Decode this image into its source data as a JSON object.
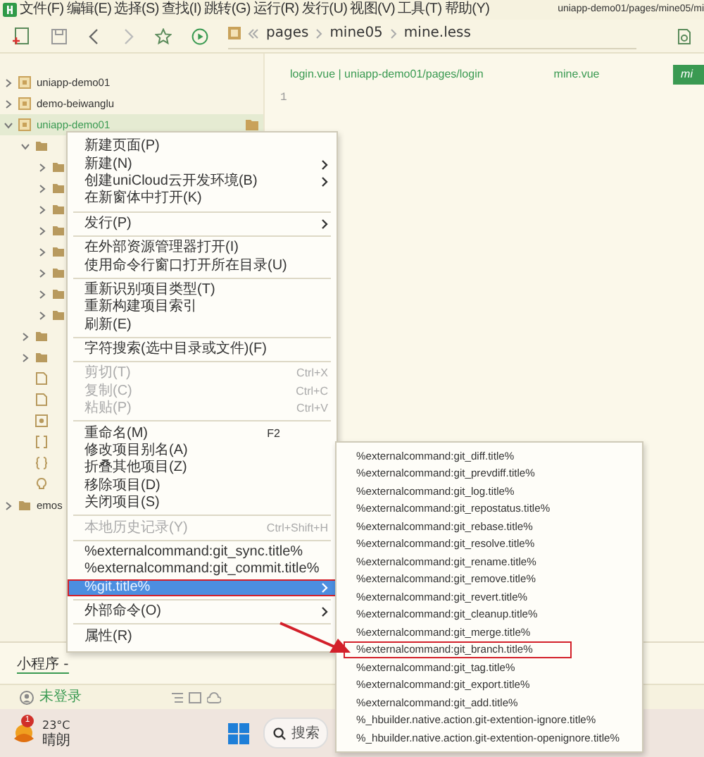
{
  "menubar": {
    "items": [
      "文件(F)",
      "编辑(E)",
      "选择(S)",
      "查找(I)",
      "跳转(G)",
      "运行(R)",
      "发行(U)",
      "视图(V)",
      "工具(T)",
      "帮助(Y)"
    ],
    "title": "uniapp-demo01/pages/mine05/mi"
  },
  "breadcrumb": [
    "pages",
    "mine05",
    "mine.less"
  ],
  "tree": [
    {
      "kind": "project",
      "label": "uniapp-demo01",
      "expanded": false,
      "selected": false
    },
    {
      "kind": "project",
      "label": "demo-beiwanglu",
      "expanded": false,
      "selected": false
    },
    {
      "kind": "project",
      "label": "uniapp-demo01",
      "expanded": true,
      "selected": true,
      "children": [
        {
          "kind": "folder",
          "expanded": true,
          "children": [
            {
              "kind": "folder",
              "expanded": false
            },
            {
              "kind": "folder",
              "expanded": false
            },
            {
              "kind": "folder",
              "expanded": false
            },
            {
              "kind": "folder",
              "expanded": false
            },
            {
              "kind": "folder",
              "expanded": false
            },
            {
              "kind": "folder",
              "expanded": false
            },
            {
              "kind": "folder",
              "expanded": false
            },
            {
              "kind": "folder",
              "expanded": false
            }
          ]
        },
        {
          "kind": "folder",
          "expanded": false
        },
        {
          "kind": "folder",
          "expanded": false
        },
        {
          "kind": "file"
        },
        {
          "kind": "file"
        },
        {
          "kind": "config"
        },
        {
          "kind": "brackets"
        },
        {
          "kind": "braces"
        },
        {
          "kind": "hint"
        }
      ]
    },
    {
      "kind": "folder",
      "label": "emos",
      "expanded": false,
      "selected": false
    }
  ],
  "editor_tabs": [
    {
      "label": "login.vue | uniapp-demo01/pages/login",
      "selected": false
    },
    {
      "label": "mine.vue",
      "selected": false
    },
    {
      "label": "mi",
      "selected": true
    }
  ],
  "line_numbers": [
    "1"
  ],
  "context_menu": [
    {
      "kind": "item",
      "label": "新建页面(P)",
      "disabled": false,
      "submenu": false,
      "selected": false,
      "annotated": false
    },
    {
      "kind": "item",
      "label": "新建(N)",
      "disabled": false,
      "submenu": true,
      "selected": false,
      "annotated": false
    },
    {
      "kind": "item",
      "label": "创建uniCloud云开发环境(B)",
      "disabled": false,
      "submenu": true,
      "selected": false,
      "annotated": false
    },
    {
      "kind": "item",
      "label": "在新窗体中打开(K)",
      "disabled": false,
      "submenu": false,
      "selected": false,
      "annotated": false
    },
    {
      "kind": "separator"
    },
    {
      "kind": "item",
      "label": "发行(P)",
      "disabled": false,
      "submenu": true,
      "selected": false,
      "annotated": false
    },
    {
      "kind": "separator"
    },
    {
      "kind": "item",
      "label": "在外部资源管理器打开(I)",
      "disabled": false,
      "submenu": false,
      "selected": false,
      "annotated": false
    },
    {
      "kind": "item",
      "label": "使用命令行窗口打开所在目录(U)",
      "disabled": false,
      "submenu": false,
      "selected": false,
      "annotated": false
    },
    {
      "kind": "separator"
    },
    {
      "kind": "item",
      "label": "重新识别项目类型(T)",
      "disabled": false,
      "submenu": false,
      "selected": false,
      "annotated": false
    },
    {
      "kind": "item",
      "label": "重新构建项目索引",
      "disabled": false,
      "submenu": false,
      "selected": false,
      "annotated": false
    },
    {
      "kind": "item",
      "label": "刷新(E)",
      "disabled": false,
      "submenu": false,
      "selected": false,
      "annotated": false
    },
    {
      "kind": "separator"
    },
    {
      "kind": "item",
      "label": "字符搜索(选中目录或文件)(F)",
      "disabled": false,
      "submenu": false,
      "selected": false,
      "annotated": false
    },
    {
      "kind": "separator"
    },
    {
      "kind": "item",
      "label": "剪切(T)",
      "shortcut": "Ctrl+X",
      "disabled": true,
      "submenu": false,
      "selected": false,
      "annotated": false
    },
    {
      "kind": "item",
      "label": "复制(C)",
      "shortcut": "Ctrl+C",
      "disabled": true,
      "submenu": false,
      "selected": false,
      "annotated": false
    },
    {
      "kind": "item",
      "label": "粘贴(P)",
      "shortcut": "Ctrl+V",
      "disabled": true,
      "submenu": false,
      "selected": false,
      "annotated": false
    },
    {
      "kind": "separator"
    },
    {
      "kind": "item",
      "label": "重命名(M)",
      "shortcut": "F2",
      "disabled": false,
      "submenu": false,
      "selected": false,
      "annotated": false
    },
    {
      "kind": "item",
      "label": "修改项目别名(A)",
      "disabled": false,
      "submenu": false,
      "selected": false,
      "annotated": false
    },
    {
      "kind": "item",
      "label": "折叠其他项目(Z)",
      "disabled": false,
      "submenu": false,
      "selected": false,
      "annotated": false
    },
    {
      "kind": "item",
      "label": "移除项目(D)",
      "disabled": false,
      "submenu": false,
      "selected": false,
      "annotated": false
    },
    {
      "kind": "item",
      "label": "关闭项目(S)",
      "disabled": false,
      "submenu": false,
      "selected": false,
      "annotated": false
    },
    {
      "kind": "separator"
    },
    {
      "kind": "item",
      "label": "本地历史记录(Y)",
      "shortcut": "Ctrl+Shift+H",
      "disabled": true,
      "submenu": false,
      "selected": false,
      "annotated": false
    },
    {
      "kind": "separator"
    },
    {
      "kind": "item",
      "label": "%externalcommand:git_sync.title%",
      "disabled": false,
      "submenu": false,
      "selected": false,
      "annotated": false
    },
    {
      "kind": "item",
      "label": "%externalcommand:git_commit.title%",
      "disabled": false,
      "submenu": false,
      "selected": false,
      "annotated": false
    },
    {
      "kind": "item",
      "label": "%git.title%",
      "disabled": false,
      "submenu": true,
      "selected": true,
      "annotated": true
    },
    {
      "kind": "separator"
    },
    {
      "kind": "item",
      "label": "外部命令(O)",
      "disabled": false,
      "submenu": true,
      "selected": false,
      "annotated": false
    },
    {
      "kind": "separator"
    },
    {
      "kind": "item",
      "label": "属性(R)",
      "disabled": false,
      "submenu": false,
      "selected": false,
      "annotated": false
    }
  ],
  "git_submenu": [
    {
      "label": "%externalcommand:git_diff.title%",
      "annotated": false
    },
    {
      "label": "%externalcommand:git_prevdiff.title%",
      "annotated": false
    },
    {
      "label": "%externalcommand:git_log.title%",
      "annotated": false
    },
    {
      "label": "%externalcommand:git_repostatus.title%",
      "annotated": false
    },
    {
      "label": "%externalcommand:git_rebase.title%",
      "annotated": false
    },
    {
      "label": "%externalcommand:git_resolve.title%",
      "annotated": false
    },
    {
      "label": "%externalcommand:git_rename.title%",
      "annotated": false
    },
    {
      "label": "%externalcommand:git_remove.title%",
      "annotated": false
    },
    {
      "label": "%externalcommand:git_revert.title%",
      "annotated": false
    },
    {
      "label": "%externalcommand:git_cleanup.title%",
      "annotated": false
    },
    {
      "label": "%externalcommand:git_merge.title%",
      "annotated": false
    },
    {
      "label": "%externalcommand:git_branch.title%",
      "annotated": true
    },
    {
      "label": "%externalcommand:git_tag.title%",
      "annotated": false
    },
    {
      "label": "%externalcommand:git_export.title%",
      "annotated": false
    },
    {
      "label": "%externalcommand:git_add.title%",
      "annotated": false
    },
    {
      "label": "%_hbuilder.native.action.git-extention-ignore.title%",
      "annotated": false
    },
    {
      "label": "%_hbuilder.native.action.git-extention-openignore.title%",
      "annotated": false
    }
  ],
  "console_tab": "小程序 -",
  "status_bar": {
    "login": "未登录"
  },
  "taskbar": {
    "weather_badge": "1",
    "temperature": "23°C",
    "condition": "晴朗",
    "search": "搜索"
  }
}
